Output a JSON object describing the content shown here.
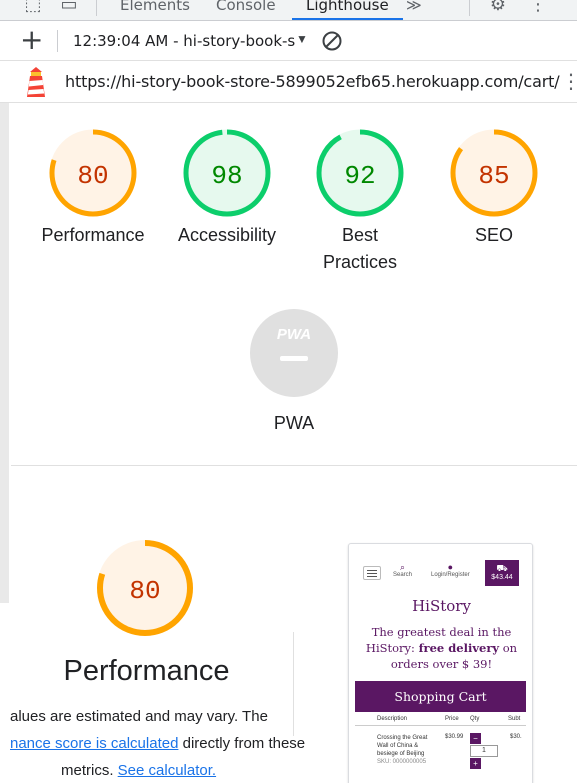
{
  "devtools": {
    "tabs": [
      {
        "label": "Elements",
        "active": false
      },
      {
        "label": "Console",
        "active": false
      },
      {
        "label": "Lighthouse",
        "active": true
      }
    ],
    "more_tabs_glyph": "≫",
    "settings_icon": "gear-icon",
    "menu_icon": "more-vert-icon"
  },
  "toolbar": {
    "add_icon": "+",
    "report_label": "12:39:04 AM - hi-story-book-s",
    "dropdown_icon": "▼",
    "clear_icon": "clear-icon"
  },
  "urlbar": {
    "url": "https://hi-story-book-store-5899052efb65.herokuapp.com/cart/",
    "menu_glyph": "⋮"
  },
  "scores": [
    {
      "key": "performance",
      "label": "Performance",
      "score": 80,
      "rating": "average"
    },
    {
      "key": "accessibility",
      "label": "Accessibility",
      "score": 98,
      "rating": "pass"
    },
    {
      "key": "best-practices",
      "label": "Best Practices",
      "score": 92,
      "rating": "pass"
    },
    {
      "key": "seo",
      "label": "SEO",
      "score": 85,
      "rating": "average"
    }
  ],
  "pwa": {
    "label": "PWA",
    "badge_text": "PWA"
  },
  "colors": {
    "average_stroke": "#ffa400",
    "average_fill": "#fff3e6",
    "average_text": "#c33300",
    "pass_stroke": "#0cce6b",
    "pass_fill": "#e6f9ee",
    "pass_text": "#008800",
    "pwa_fill": "#e0e0e0",
    "link": "#1a73e8",
    "brand_purple": "#5a1763"
  },
  "performance_section": {
    "score": 80,
    "title": "Performance",
    "line1": "alues are estimated and may vary. The",
    "line2_link": "nance score is calculated",
    "line2_rest": " directly from these",
    "line3_prefix": "metrics. ",
    "line3_link": "See calculator."
  },
  "thumbnail": {
    "nav_search": "Search",
    "nav_login": "Login/Register",
    "cart_total": "$43.44",
    "brand": "HiStory",
    "tagline_part1": "The greatest deal in the HiStory: ",
    "tagline_bold": "free delivery",
    "tagline_part2": " on orders over $ 39!",
    "banner": "Shopping Cart",
    "col_description": "Description",
    "col_price": "Price",
    "col_qty": "Qty",
    "col_subtotal": "Subt",
    "item_title": "Crossing the Great Wall of China & besiege of Beijing",
    "item_sku": "SKU: 0000000005",
    "item_price": "$30.99",
    "item_subtotal": "$30.",
    "qty_value": "1",
    "minus_glyph": "−",
    "plus_glyph": "+"
  }
}
